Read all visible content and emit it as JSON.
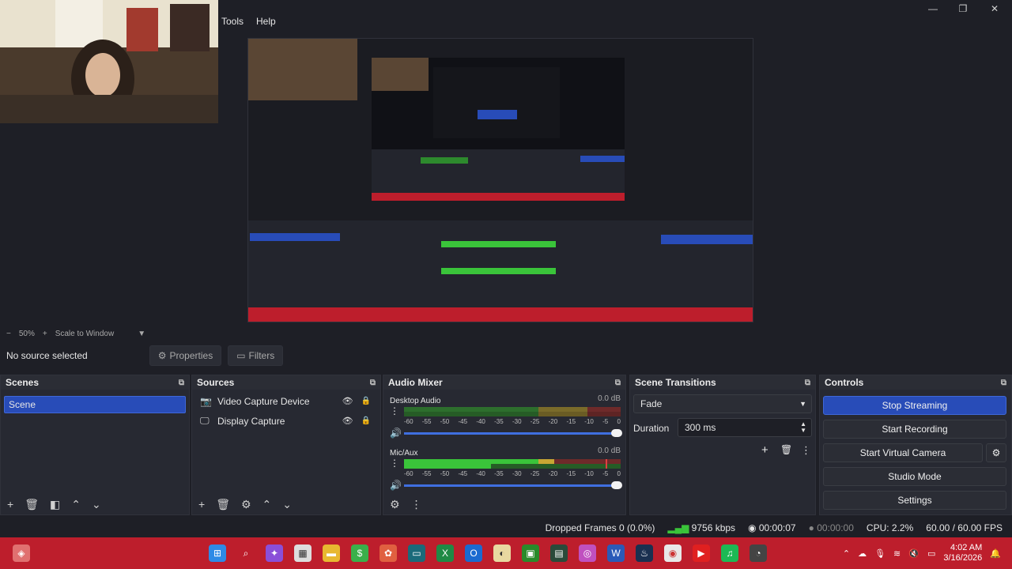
{
  "menu": [
    "Tools",
    "Help"
  ],
  "window_controls": [
    "—",
    "❐",
    "✕"
  ],
  "zoom": {
    "level": "50%",
    "mode": "Scale to Window"
  },
  "context": {
    "no_source": "No source selected",
    "properties": "Properties",
    "filters": "Filters"
  },
  "scenes": {
    "title": "Scenes",
    "items": [
      "Scene"
    ]
  },
  "sources": {
    "title": "Sources",
    "items": [
      {
        "label": "Video Capture Device",
        "icon": "camera-icon"
      },
      {
        "label": "Display Capture",
        "icon": "monitor-icon"
      }
    ]
  },
  "mixer": {
    "title": "Audio Mixer",
    "channels": [
      {
        "name": "Desktop Audio",
        "db": "0.0 dB",
        "level": 0.0
      },
      {
        "name": "Mic/Aux",
        "db": "0.0 dB",
        "level": 0.7
      }
    ],
    "ticks": [
      "-60",
      "-55",
      "-50",
      "-45",
      "-40",
      "-35",
      "-30",
      "-25",
      "-20",
      "-15",
      "-10",
      "-5",
      "0"
    ]
  },
  "transitions": {
    "title": "Scene Transitions",
    "selected": "Fade",
    "duration_label": "Duration",
    "duration_value": "300 ms"
  },
  "controls": {
    "title": "Controls",
    "stop_streaming": "Stop Streaming",
    "start_recording": "Start Recording",
    "start_virtual_camera": "Start Virtual Camera",
    "studio_mode": "Studio Mode",
    "settings": "Settings"
  },
  "status": {
    "dropped_frames": "Dropped Frames 0 (0.0%)",
    "bitrate": "9756 kbps",
    "stream_time": "00:00:07",
    "rec_time": "00:00:00",
    "cpu": "CPU: 2.2%",
    "fps": "60.00 / 60.00 FPS"
  },
  "clock": {
    "time": "4:02 AM",
    "date": "3/16/2026"
  },
  "colors": {
    "accent": "#284cb8",
    "taskbar": "#bd1e2c",
    "meter_green": "#3ac43a",
    "meter_yellow": "#c8a634",
    "meter_red": "#c43a3a"
  }
}
